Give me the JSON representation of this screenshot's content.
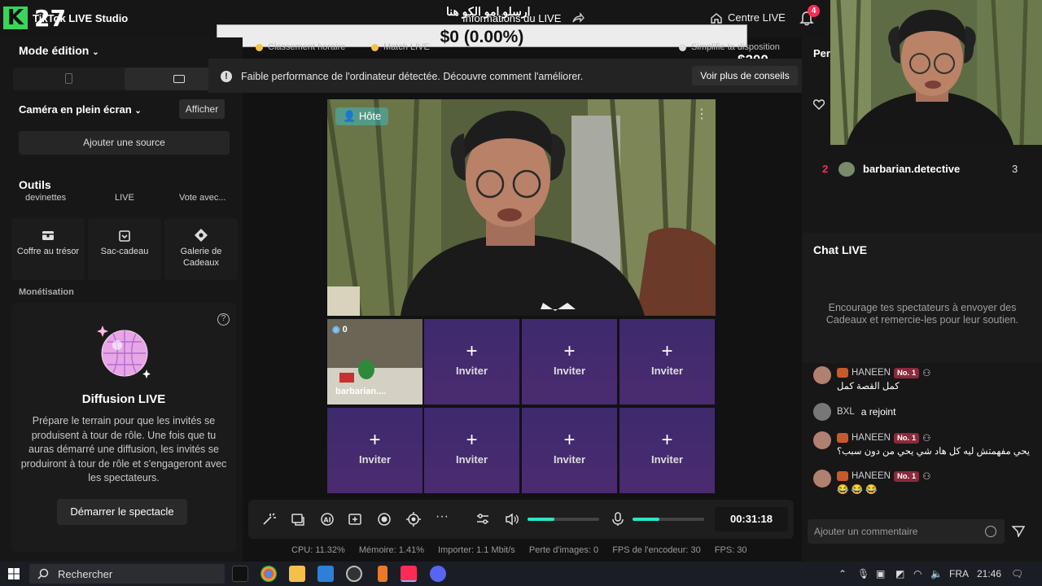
{
  "overlay": {
    "k_logo": "K",
    "count": "27",
    "goal_bar_text": "$0 (0.00%)",
    "goal_left": "$0",
    "goal_right": "$200",
    "stream_title": "ارسلو امو الكو هنا"
  },
  "topbar": {
    "app_title": "TikTok LIVE Studio",
    "live_info": "Informations du LIVE",
    "centre_live": "Centre LIVE",
    "notification_count": "4",
    "subtabs": [
      "Classement horaire",
      "Match LIVE",
      "Simplifie ta disposition"
    ]
  },
  "left_panel": {
    "mode_edition": "Mode édition",
    "camera_label": "Caméra en plein écran",
    "show_button": "Afficher",
    "add_source": "Ajouter une source",
    "tools_title": "Outils",
    "cut_labels": [
      "devinettes",
      "LIVE",
      "Vote avec..."
    ],
    "tools": [
      {
        "label": "Coffre au trésor",
        "icon": "treasure-chest-icon"
      },
      {
        "label": "Sac-cadeau",
        "icon": "gift-bag-icon"
      },
      {
        "label": "Galerie de Cadeaux",
        "icon": "gift-gallery-icon"
      }
    ],
    "monetisation": "Monétisation",
    "diffusion": {
      "title": "Diffusion LIVE",
      "description": "Prépare le terrain pour que les invités se produisent à tour de rôle. Une fois que tu auras démarré une diffusion, les invités se produiront à tour de rôle et s'engageront avec les spectateurs.",
      "button": "Démarrer le spectacle"
    }
  },
  "center": {
    "warning": "Faible performance de l'ordinateur détectée. Découvre comment l'améliorer.",
    "warning_button": "Voir plus de conseils",
    "host_badge": "Hôte",
    "guest_name": "barbarian....",
    "guest_count": "0",
    "invite_label": "Inviter",
    "timer": "00:31:18",
    "volume_speaker": 0.38,
    "volume_mic": 0.38
  },
  "stats": {
    "cpu": "CPU: 11.32%",
    "memory": "Mémoire: 1.41%",
    "import": "Importer: 1.1 Mbit/s",
    "frame_loss": "Perte d'images: 0",
    "encoder_fps": "FPS de l'encodeur: 30",
    "fps": "FPS: 30"
  },
  "right_panel": {
    "per_label": "Per",
    "ranking": [
      {
        "rank": "2",
        "name": "barbarian.detective",
        "score": "3"
      }
    ],
    "chat_title": "Chat LIVE",
    "chat_encourage": "Encourage tes spectateurs à envoyer des Cadeaux et remercie-les pour leur soutien.",
    "messages": [
      {
        "user": "HANEEN",
        "badge": "No. 1",
        "text": "كمل القصة كمل"
      },
      {
        "user": "BXL",
        "badge": "",
        "text": "a rejoint"
      },
      {
        "user": "HANEEN",
        "badge": "No. 1",
        "text": "يحي مفهمتش ليه كل هاد شي يحي من دون سبب؟"
      },
      {
        "user": "HANEEN",
        "badge": "No. 1",
        "text": "😂 😂 😂"
      }
    ],
    "comment_placeholder": "Ajouter un commentaire"
  },
  "taskbar": {
    "search": "Rechercher",
    "lang": "FRA",
    "time": "21:46"
  },
  "colors": {
    "accent_red": "#fe2c55",
    "accent_teal": "#2ce6c5",
    "invite_purple": "#45296f"
  }
}
